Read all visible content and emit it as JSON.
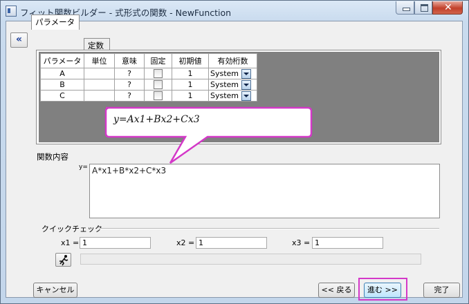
{
  "window": {
    "title": "フィット関数ビルダー - 式形式の関数 - NewFunction",
    "close_glyph": "✕"
  },
  "collapse_button": {
    "label": "«"
  },
  "tabs": [
    {
      "label": "パラメータ",
      "selected": true
    },
    {
      "label": "定数",
      "selected": false
    }
  ],
  "param_table": {
    "headers": [
      "パラメータ",
      "単位",
      "意味",
      "固定",
      "初期値",
      "有効桁数"
    ],
    "rows": [
      {
        "name": "A",
        "unit": "",
        "meaning": "?",
        "fixed": false,
        "initial": "1",
        "sig": "System"
      },
      {
        "name": "B",
        "unit": "",
        "meaning": "?",
        "fixed": false,
        "initial": "1",
        "sig": "System"
      },
      {
        "name": "C",
        "unit": "",
        "meaning": "?",
        "fixed": false,
        "initial": "1",
        "sig": "System"
      }
    ]
  },
  "callout": {
    "formula": "y=Ax1+Bx2+Cx3",
    "border_color": "#d438c8"
  },
  "function_section": {
    "label": "関数内容",
    "y_label": "y=",
    "body": "A*x1+B*x2+C*x3"
  },
  "quick_check": {
    "label": "クイックチェック",
    "inputs": [
      {
        "label": "x1 =",
        "value": "1"
      },
      {
        "label": "x2 =",
        "value": "1"
      },
      {
        "label": "x3 =",
        "value": "1"
      }
    ]
  },
  "buttons": {
    "cancel": "キャンセル",
    "back": "<< 戻る",
    "next": "進む >>",
    "finish": "完了"
  },
  "colors": {
    "highlight": "#d438c8",
    "grid_bg": "#808080"
  }
}
